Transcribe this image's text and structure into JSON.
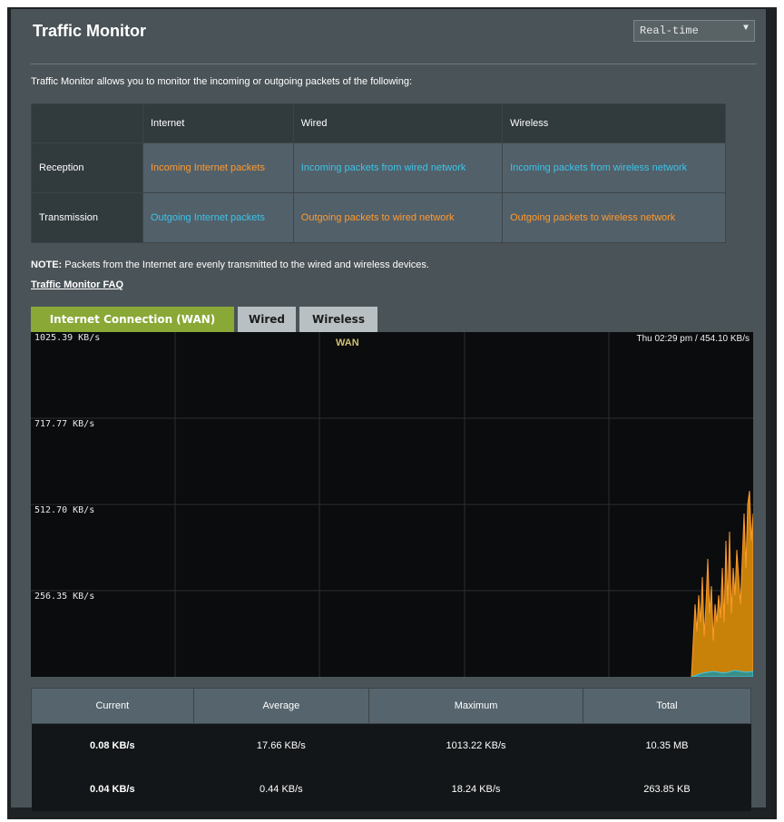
{
  "header": {
    "title": "Traffic Monitor",
    "mode_select": "Real-time"
  },
  "description": "Traffic Monitor allows you to monitor the incoming or outgoing packets of the following:",
  "packet_table": {
    "columns": [
      "Internet",
      "Wired",
      "Wireless"
    ],
    "rows": [
      {
        "label": "Reception",
        "cells": [
          "Incoming Internet packets",
          "Incoming packets from wired network",
          "Incoming packets from wireless network"
        ]
      },
      {
        "label": "Transmission",
        "cells": [
          "Outgoing Internet packets",
          "Outgoing packets to wired network",
          "Outgoing packets to wireless network"
        ]
      }
    ]
  },
  "note": {
    "prefix": "NOTE:",
    "text": "Packets from the Internet are evenly transmitted to the wired and wireless devices."
  },
  "faq_link": "Traffic Monitor FAQ",
  "tabs": [
    {
      "label": "Internet Connection (WAN)",
      "active": true
    },
    {
      "label": "Wired",
      "active": false
    },
    {
      "label": "Wireless",
      "active": false
    }
  ],
  "graph": {
    "title": "WAN",
    "timestamp": "Thu 02:29 pm / 454.10 KB/s",
    "y_labels": [
      "1025.39 KB/s",
      "717.77 KB/s",
      "512.70 KB/s",
      "256.35 KB/s"
    ]
  },
  "stats": {
    "headers": [
      "Current",
      "Average",
      "Maximum",
      "Total"
    ],
    "rows": [
      {
        "current": "0.08 KB/s",
        "average": "17.66 KB/s",
        "maximum": "1013.22 KB/s",
        "total": "10.35 MB"
      },
      {
        "current": "0.04 KB/s",
        "average": "0.44 KB/s",
        "maximum": "18.24 KB/s",
        "total": "263.85 KB"
      }
    ]
  },
  "colors": {
    "reception": "#ff9a2e",
    "transmission": "#3cc4e8",
    "active_tab": "#8aa836"
  }
}
